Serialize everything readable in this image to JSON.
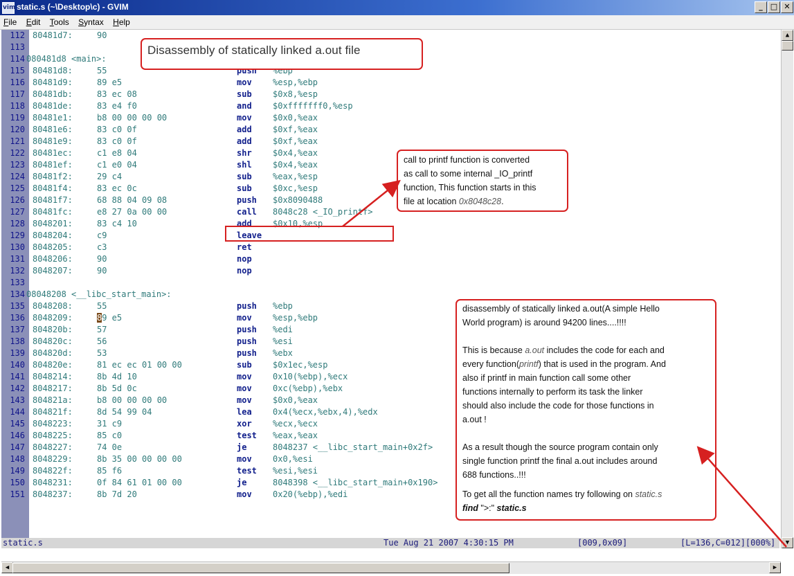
{
  "window": {
    "icon": "vim-icon",
    "title": "static.s (~\\Desktop\\c) - GVIM",
    "controls": {
      "minimize": "_",
      "maximize": "□",
      "close": "✕"
    }
  },
  "menu": [
    {
      "prefix": "",
      "key": "F",
      "rest": "ile"
    },
    {
      "prefix": "",
      "key": "E",
      "rest": "dit"
    },
    {
      "prefix": "",
      "key": "T",
      "rest": "ools"
    },
    {
      "prefix": "",
      "key": "S",
      "rest": "yntax"
    },
    {
      "prefix": "",
      "key": "H",
      "rest": "elp"
    }
  ],
  "lines": [
    {
      "n": "112",
      "addr": "80481d7:",
      "bytes": "90",
      "mn": "",
      "ops": ""
    },
    {
      "n": "113",
      "label": ""
    },
    {
      "n": "114",
      "label": "080481d8 <main>:"
    },
    {
      "n": "115",
      "addr": "80481d8:",
      "bytes": "55",
      "mn": "push",
      "ops": "%ebp"
    },
    {
      "n": "116",
      "addr": "80481d9:",
      "bytes": "89 e5",
      "mn": "mov",
      "ops": "%esp,%ebp"
    },
    {
      "n": "117",
      "addr": "80481db:",
      "bytes": "83 ec 08",
      "mn": "sub",
      "ops": "$0x8,%esp"
    },
    {
      "n": "118",
      "addr": "80481de:",
      "bytes": "83 e4 f0",
      "mn": "and",
      "ops": "$0xfffffff0,%esp"
    },
    {
      "n": "119",
      "addr": "80481e1:",
      "bytes": "b8 00 00 00 00",
      "mn": "mov",
      "ops": "$0x0,%eax"
    },
    {
      "n": "120",
      "addr": "80481e6:",
      "bytes": "83 c0 0f",
      "mn": "add",
      "ops": "$0xf,%eax"
    },
    {
      "n": "121",
      "addr": "80481e9:",
      "bytes": "83 c0 0f",
      "mn": "add",
      "ops": "$0xf,%eax"
    },
    {
      "n": "122",
      "addr": "80481ec:",
      "bytes": "c1 e8 04",
      "mn": "shr",
      "ops": "$0x4,%eax"
    },
    {
      "n": "123",
      "addr": "80481ef:",
      "bytes": "c1 e0 04",
      "mn": "shl",
      "ops": "$0x4,%eax"
    },
    {
      "n": "124",
      "addr": "80481f2:",
      "bytes": "29 c4",
      "mn": "sub",
      "ops": "%eax,%esp"
    },
    {
      "n": "125",
      "addr": "80481f4:",
      "bytes": "83 ec 0c",
      "mn": "sub",
      "ops": "$0xc,%esp"
    },
    {
      "n": "126",
      "addr": "80481f7:",
      "bytes": "68 88 04 09 08",
      "mn": "push",
      "ops": "$0x8090488"
    },
    {
      "n": "127",
      "addr": "80481fc:",
      "bytes": "e8 27 0a 00 00",
      "mn": "call",
      "ops": "8048c28 <_IO_printf>"
    },
    {
      "n": "128",
      "addr": "8048201:",
      "bytes": "83 c4 10",
      "mn": "add",
      "ops": "$0x10,%esp"
    },
    {
      "n": "129",
      "addr": "8048204:",
      "bytes": "c9",
      "mn": "leave",
      "ops": ""
    },
    {
      "n": "130",
      "addr": "8048205:",
      "bytes": "c3",
      "mn": "ret",
      "ops": ""
    },
    {
      "n": "131",
      "addr": "8048206:",
      "bytes": "90",
      "mn": "nop",
      "ops": ""
    },
    {
      "n": "132",
      "addr": "8048207:",
      "bytes": "90",
      "mn": "nop",
      "ops": ""
    },
    {
      "n": "133",
      "label": ""
    },
    {
      "n": "134",
      "label": "08048208 <__libc_start_main>:"
    },
    {
      "n": "135",
      "addr": "8048208:",
      "bytes": "55",
      "mn": "push",
      "ops": "%ebp"
    },
    {
      "n": "136",
      "addr": "8048209:",
      "bytes": "89 e5",
      "mn": "mov",
      "ops": "%esp,%ebp",
      "cursor": true
    },
    {
      "n": "137",
      "addr": "804820b:",
      "bytes": "57",
      "mn": "push",
      "ops": "%edi"
    },
    {
      "n": "138",
      "addr": "804820c:",
      "bytes": "56",
      "mn": "push",
      "ops": "%esi"
    },
    {
      "n": "139",
      "addr": "804820d:",
      "bytes": "53",
      "mn": "push",
      "ops": "%ebx"
    },
    {
      "n": "140",
      "addr": "804820e:",
      "bytes": "81 ec ec 01 00 00",
      "mn": "sub",
      "ops": "$0x1ec,%esp"
    },
    {
      "n": "141",
      "addr": "8048214:",
      "bytes": "8b 4d 10",
      "mn": "mov",
      "ops": "0x10(%ebp),%ecx"
    },
    {
      "n": "142",
      "addr": "8048217:",
      "bytes": "8b 5d 0c",
      "mn": "mov",
      "ops": "0xc(%ebp),%ebx"
    },
    {
      "n": "143",
      "addr": "804821a:",
      "bytes": "b8 00 00 00 00",
      "mn": "mov",
      "ops": "$0x0,%eax"
    },
    {
      "n": "144",
      "addr": "804821f:",
      "bytes": "8d 54 99 04",
      "mn": "lea",
      "ops": "0x4(%ecx,%ebx,4),%edx"
    },
    {
      "n": "145",
      "addr": "8048223:",
      "bytes": "31 c9",
      "mn": "xor",
      "ops": "%ecx,%ecx"
    },
    {
      "n": "146",
      "addr": "8048225:",
      "bytes": "85 c0",
      "mn": "test",
      "ops": "%eax,%eax"
    },
    {
      "n": "147",
      "addr": "8048227:",
      "bytes": "74 0e",
      "mn": "je",
      "ops": "8048237 <__libc_start_main+0x2f>"
    },
    {
      "n": "148",
      "addr": "8048229:",
      "bytes": "8b 35 00 00 00 00",
      "mn": "mov",
      "ops": "0x0,%esi"
    },
    {
      "n": "149",
      "addr": "804822f:",
      "bytes": "85 f6",
      "mn": "test",
      "ops": "%esi,%esi"
    },
    {
      "n": "150",
      "addr": "8048231:",
      "bytes": "0f 84 61 01 00 00",
      "mn": "je",
      "ops": "8048398 <__libc_start_main+0x190>"
    },
    {
      "n": "151",
      "addr": "8048237:",
      "bytes": "8b 7d 20",
      "mn": "mov",
      "ops": "0x20(%ebp),%edi"
    }
  ],
  "status": {
    "file": "static.s",
    "datetime": "Tue Aug 21 2007 4:30:15 PM",
    "char": "[009,0x09]",
    "position": "[L=136,C=012][000%]"
  },
  "annotations": {
    "banner": "Disassembly of statically linked a.out file",
    "note1": {
      "l1": "call to printf function is converted",
      "l2": "as call to some internal _IO_printf",
      "l3": "function, This function starts in this",
      "l4a": "file at location ",
      "l4b": "0x8048c28",
      "l4c": "."
    },
    "note2": {
      "p1a": "disassembly of statically linked a.out(A simple Hello",
      "p1b": "World program) is around 94200 lines....!!!!",
      "p2a_pre": "This is because ",
      "p2a_it": "a.out",
      "p2a_post": " includes the code for each and",
      "p2b_pre": "every function(",
      "p2b_it": "printf",
      "p2b_post": ") that is used in the program. And",
      "p2c": "also if printf in main function call some other",
      "p2d": "functions internally to perform its task the linker",
      "p2e": "should also include the code for those functions in",
      "p2f": "a.out !",
      "p3a": "As a result though the source program contain only",
      "p3b": "single function printf  the final a.out includes around",
      "p3c": "688 functions..!!!",
      "p4a_pre": "To get all the function names  try following on ",
      "p4a_it": "static.s",
      "p4b_bi": "find",
      "p4b_mid": " \">:\" ",
      "p4b_bi2": "static.s"
    }
  },
  "colors": {
    "annotation_red": "#d62020",
    "gutter": "#8b90b8"
  }
}
